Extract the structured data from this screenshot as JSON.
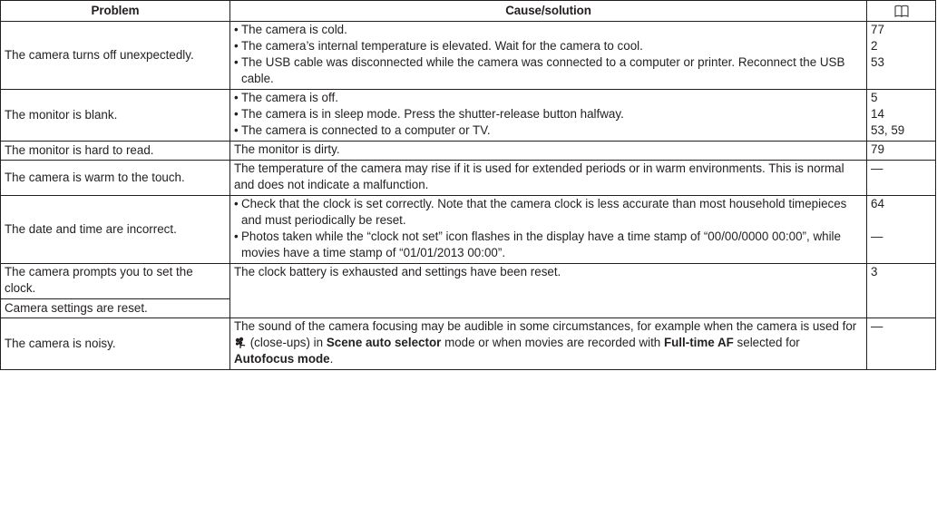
{
  "header": {
    "problem": "Problem",
    "cause": "Cause/solution",
    "ref_icon": "book-icon"
  },
  "rows": [
    {
      "problem": "The camera turns off unexpectedly.",
      "causes": [
        "The camera is cold.",
        "The camera’s internal temperature is elevated. Wait for the camera to cool.",
        "The USB cable was disconnected while the camera was connected to a computer or printer. Reconnect the USB cable."
      ],
      "refs": [
        "77",
        "2",
        "53"
      ]
    },
    {
      "problem": "The monitor is blank.",
      "causes": [
        "The camera is off.",
        "The camera is in sleep mode. Press the shutter-release button halfway.",
        "The camera is connected to a computer or TV."
      ],
      "refs": [
        "5",
        "14",
        "53, 59"
      ]
    },
    {
      "problem": "The monitor is hard to read.",
      "cause": "The monitor is dirty.",
      "ref": "79"
    },
    {
      "problem": "The camera is warm to the touch.",
      "cause": "The temperature of the camera may rise if it is used for extended periods or in warm environments. This is normal and does not indicate a malfunction.",
      "ref": "—"
    },
    {
      "problem": "The date and time are incorrect.",
      "causes": [
        "Check that the clock is set correctly. Note that the camera clock is less accurate than most household timepieces and must periodically be reset.",
        "Photos taken while the “clock not set” icon flashes in the display have a time stamp of “00/00/0000 00:00”, while movies have a time stamp of “01/01/2013 00:00”."
      ],
      "refs": [
        "64",
        "—"
      ]
    },
    {
      "problem_a": "The camera prompts you to set the clock.",
      "problem_b": "Camera settings are reset.",
      "cause": "The clock battery is exhausted and settings have been reset.",
      "ref": "3"
    },
    {
      "problem": "The camera is noisy.",
      "cause_parts": {
        "p1": "The sound of the camera focusing may be audible in some circumstances, for example when the camera is used for ",
        "icon": "close-up-scene-icon",
        "p2": " (close-ups) in ",
        "b1": "Scene auto selector",
        "p3": " mode or when movies are recorded with ",
        "b2": "Full-time AF",
        "p4": " selected for ",
        "b3": "Autofocus mode",
        "p5": "."
      },
      "ref": "—"
    }
  ]
}
